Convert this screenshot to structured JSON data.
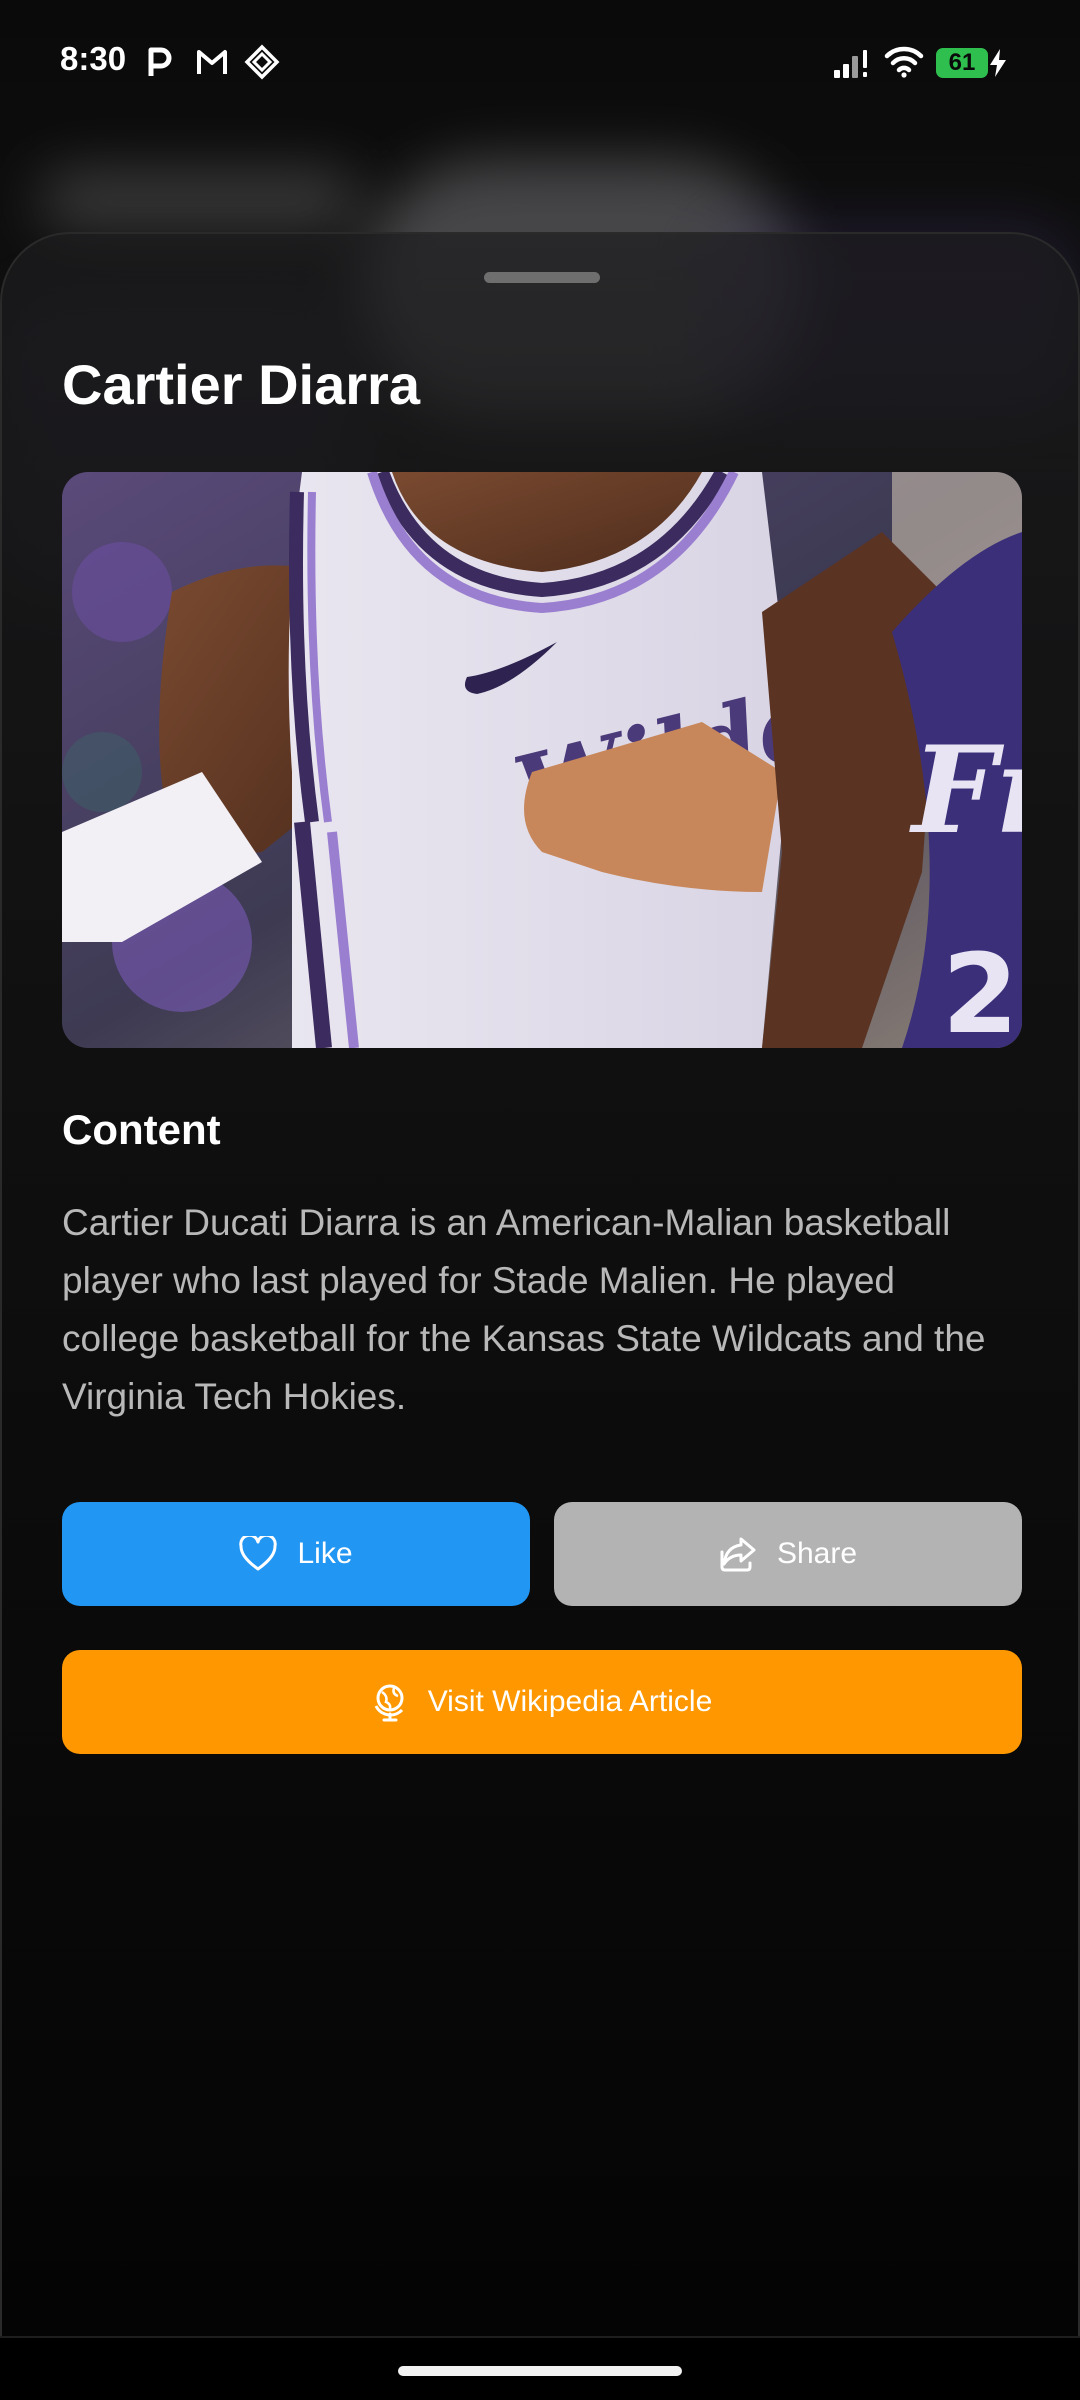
{
  "status_bar": {
    "time": "8:30",
    "battery_level": "61",
    "left_icons": [
      "parking-icon",
      "gmail-icon",
      "diamond-icon"
    ],
    "right_icons": [
      "signal-icon",
      "wifi-icon",
      "battery-icon",
      "charging-icon"
    ]
  },
  "sheet": {
    "title": "Cartier Diarra",
    "image_alt": "Basketball player in a white and purple Wildcats jersey",
    "section_heading": "Content",
    "description": "Cartier Ducati Diarra is an American-Malian basketball player who last played for Stade Malien. He played college basketball for the Kansas State Wildcats and the Virginia Tech Hokies."
  },
  "actions": {
    "like_label": "Like",
    "share_label": "Share",
    "wiki_label": "Visit Wikipedia Article"
  },
  "colors": {
    "like": "#2196f3",
    "share": "#b3b3b3",
    "wiki": "#ff9800",
    "battery": "#2fbf4e"
  }
}
